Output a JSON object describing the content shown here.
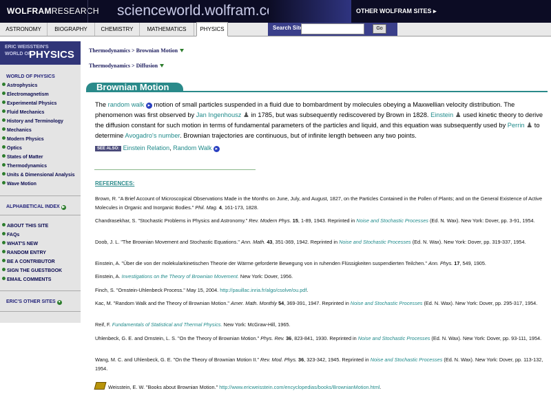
{
  "header": {
    "brand_bold": "WOLFRAM",
    "brand_light": "RESEARCH",
    "site": "scienceworld.wolfram.com",
    "other_sites": "OTHER WOLFRAM SITES ▸"
  },
  "tabs": [
    "ASTRONOMY",
    "BIOGRAPHY",
    "CHEMISTRY",
    "MATHEMATICS",
    "PHYSICS"
  ],
  "search": {
    "label": "Search Site",
    "placeholder": "",
    "go": "Go"
  },
  "sidebar": {
    "logo_l1": "ERIC WEISSTEIN'S",
    "logo_l2": "WORLD OF",
    "logo_l3": "PHYSICS",
    "world_head": "WORLD OF PHYSICS",
    "topics": [
      "Astrophysics",
      "Electromagnetism",
      "Experimental Physics",
      "Fluid Mechanics",
      "History and Terminology",
      "Mechanics",
      "Modern Physics",
      "Optics",
      "States of Matter",
      "Thermodynamics",
      "Units & Dimensional Analysis",
      "Wave Motion"
    ],
    "alpha_index": "ALPHABETICAL INDEX",
    "links": [
      "ABOUT THIS SITE",
      "FAQs",
      "WHAT'S NEW",
      "RANDOM ENTRY",
      "BE A CONTRIBUTOR",
      "SIGN THE GUESTBOOK",
      "EMAIL COMMENTS"
    ],
    "other_sites": "ERIC'S OTHER SITES"
  },
  "breadcrumbs": [
    {
      "a": "Thermodynamics",
      "b": "Brownian Motion"
    },
    {
      "a": "Thermodynamics",
      "b": "Diffusion"
    }
  ],
  "title": "Brownian Motion",
  "body": {
    "p1_a": "The ",
    "random_walk": "random walk",
    "p1_b": " motion of small particles suspended in a fluid due to bombardment by molecules obeying a Maxwellian velocity distribution. The phenomenon was first observed by ",
    "ingenhousz": "Jan Ingenhousz",
    "p1_c": " in 1785, but was subsequently rediscovered by Brown in 1828. ",
    "einstein": "Einstein",
    "p1_d": " used kinetic theory to derive the diffusion constant for such motion in terms of fundamental parameters of the particles and liquid, and this equation was subsequently used by ",
    "perrin": "Perrin",
    "p1_e": " to determine ",
    "avogadro": "Avogadro's number",
    "p1_f": ". Brownian trajectories are continuous, but of infinite length between any two points."
  },
  "see_also": {
    "tag": "SEE ALSO:",
    "link1": "Einstein Relation",
    "comma": ", ",
    "link2": "Random Walk"
  },
  "references_heading": "REFERENCES:",
  "references": [
    {
      "a": "Brown, R. \"A Brief Account of Microscopical Observations Made in the Months on June, July, and August, 1827, on the Particles Contained in the Pollen of Plants; and on the General Existence of Active Molecules in Organic and Inorganic Bodies.\" ",
      "i": "Phil. Mag.",
      "b": " 4",
      "c": ", 161-173, 1828."
    },
    {
      "a": "Chandrasekhar, S. \"Stochastic Problems in Physics and Astronomy.\" ",
      "i": "Rev. Modern Phys.",
      "b": " 15",
      "c": ", 1-89, 1943. Reprinted in ",
      "l": "Noise and Stochastic Processes",
      "d": " (Ed. N. Wax). New York: Dover, pp. 3-91, 1954."
    },
    {
      "a": "Doob, J. L. \"The Brownian Movement and Stochastic Equations.\" ",
      "i": "Ann. Math.",
      "b": " 43",
      "c": ", 351-369, 1942. Reprinted in ",
      "l": "Noise and Stochastic Processes",
      "d": " (Ed. N. Wax). New York: Dover, pp. 319-337, 1954."
    },
    {
      "a": "Einstein, A. \"Über die von der molekularkinetischen Theorie der Wärme geforderte Bewegung von in ruhenden Flüssigkeiten suspendierten Teilchen.\" ",
      "i": "Ann. Phys.",
      "b": " 17",
      "c": ", 549, 1905."
    },
    {
      "a": "Einstein, A. ",
      "l": "Investigations on the Theory of Brownian Movement.",
      "d": " New York: Dover, 1956."
    },
    {
      "a": "Finch, S. \"Ornstein-Uhlenbeck Process.\" May 15, 2004. ",
      "u": "http://pauillac.inria.fr/algo/csolve/ou.pdf",
      "d": "."
    },
    {
      "a": "Kac, M. \"Random Walk and the Theory of Brownian Motion.\" ",
      "i": "Amer. Math. Monthly",
      "b": " 54",
      "c": ", 369-391, 1947. Reprinted in ",
      "l": "Noise and Stochastic Processes",
      "d": " (Ed. N. Wax). New York: Dover, pp. 295-317, 1954."
    },
    {
      "a": "Reif, F. ",
      "l": "Fundamentals of Statistical and Thermal Physics.",
      "d": " New York: McGraw-Hill, 1965."
    },
    {
      "a": "Uhlenbeck, G. E. and Ornstein, L. S. \"On the Theory of Brownian Motion.\" ",
      "i": "Phys. Rev.",
      "b": " 36",
      "c": ", 823-841, 1930. Reprinted in ",
      "l": "Noise and Stochastic Processes",
      "d": " (Ed. N. Wax). New York: Dover, pp. 93-111, 1954."
    },
    {
      "a": "Wang, M. C. and Uhlenbeck, G. E. \"On the Theory of Brownian Motion II.\" ",
      "i": "Rev. Mod. Phys.",
      "b": " 36",
      "c": ", 323-342, 1945. Reprinted in ",
      "l": "Noise and Stochastic Processes",
      "d": " (Ed. N. Wax). New York: Dover, pp. 113-132, 1954."
    }
  ],
  "books": {
    "a": "Weisstein, E. W. \"Books about Brownian Motion.\" ",
    "u": "http://www.ericweisstein.com/encyclopedias/books/BrownianMotion.html",
    "d": "."
  },
  "colors": {
    "teal": "#2a8a8a",
    "navy": "#303578",
    "green": "#2d7d2d"
  }
}
